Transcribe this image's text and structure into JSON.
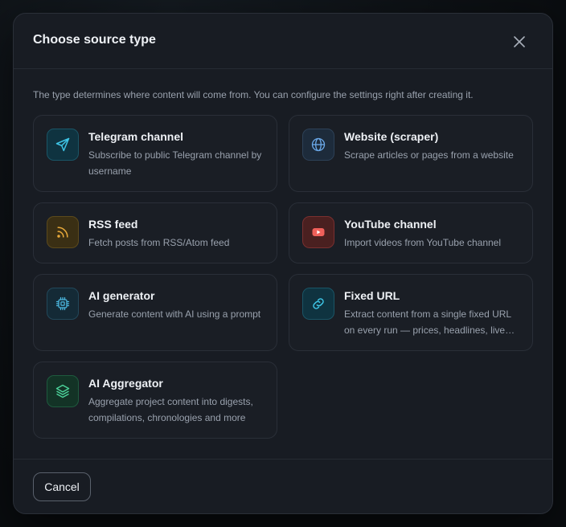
{
  "modal": {
    "title": "Choose source type",
    "description": "The type determines where content will come from. You can configure the settings right after creating it.",
    "cancel_label": "Cancel"
  },
  "sources": [
    {
      "title": "Telegram channel",
      "description": "Subscribe to public Telegram channel by username",
      "icon": "send-icon",
      "color": "#3ec5e6"
    },
    {
      "title": "Website (scraper)",
      "description": "Scrape articles or pages from a website",
      "icon": "globe-icon",
      "color": "#6aa8e8"
    },
    {
      "title": "RSS feed",
      "description": "Fetch posts from RSS/Atom feed",
      "icon": "rss-icon",
      "color": "#e8a93a"
    },
    {
      "title": "YouTube channel",
      "description": "Import videos from YouTube channel",
      "icon": "youtube-icon",
      "color": "#f0605a"
    },
    {
      "title": "AI generator",
      "description": "Generate content with AI using a prompt",
      "icon": "cpu-chip-icon",
      "color": "#4bb8e0"
    },
    {
      "title": "Fixed URL",
      "description": "Extract content from a single fixed URL on every run — prices, headlines, live…",
      "icon": "link-icon",
      "color": "#3ec5e6"
    },
    {
      "title": "AI Aggregator",
      "description": "Aggregate project content into digests, compilations, chronologies and more",
      "icon": "layers-icon",
      "color": "#4cd39a"
    }
  ]
}
